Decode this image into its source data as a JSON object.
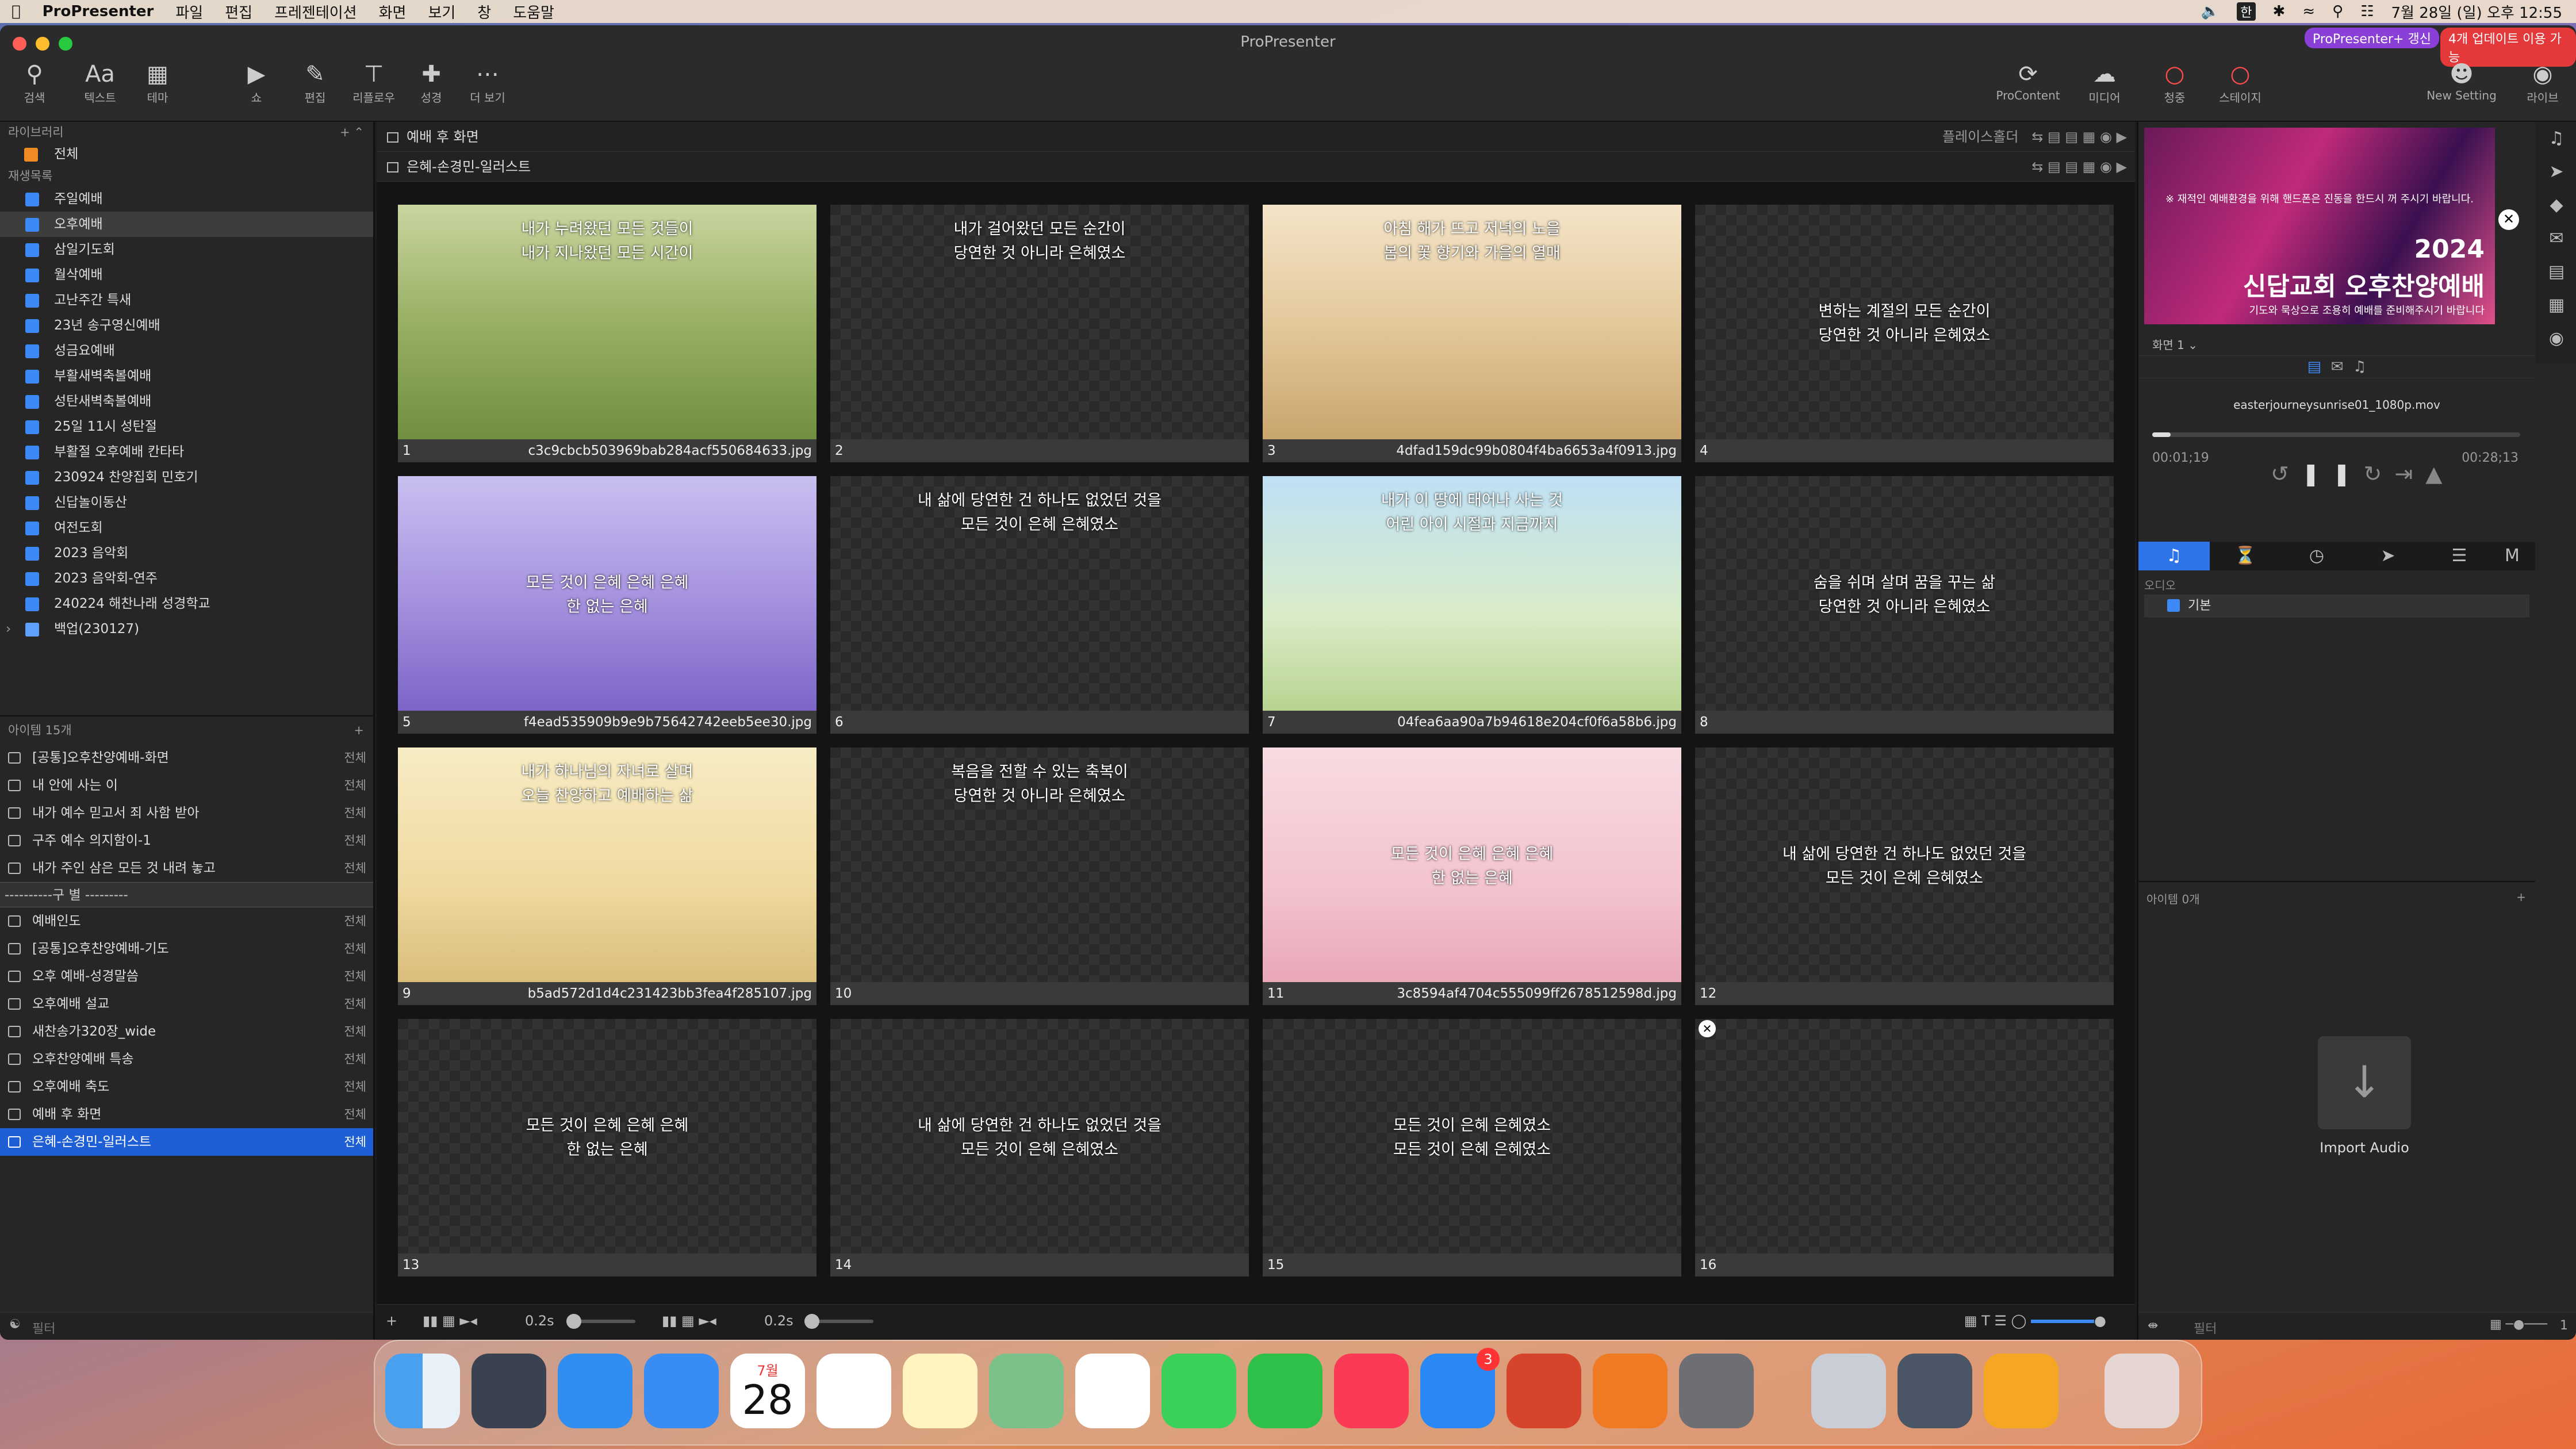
{
  "menubar": {
    "app": "ProPresenter",
    "items": [
      "파일",
      "편집",
      "프레젠테이션",
      "화면",
      "보기",
      "창",
      "도움말"
    ],
    "badge1": "ProPresenter+ 갱신",
    "badge2": "4개 업데이트 이용 가능",
    "clock": "7월 28일 (일) 오후 12:55",
    "ime": "한"
  },
  "window": {
    "title": "ProPresenter"
  },
  "toolbar": {
    "search": "검색",
    "text": "텍스트",
    "theme": "테마",
    "show": "쇼",
    "edit": "편집",
    "reflow": "리플로우",
    "bible": "성경",
    "more": "더 보기",
    "procontent": "ProContent",
    "media": "미디어",
    "audio": "청중",
    "stage": "스테이지",
    "newsetting": "New Setting",
    "live": "라이브"
  },
  "library": {
    "header": "라이브러리",
    "all": "전체",
    "playlists_header": "재생목록",
    "playlists": [
      "주일예배",
      "오후예배",
      "삼일기도회",
      "월삭예배",
      "고난주간 특새",
      "23년 송구영신예배",
      "성금요예배",
      "부활새벽축볼예배",
      "성탄새벽축볼예배",
      "25일 11시 성탄절",
      "부활절 오후예배 칸타타",
      "230924 찬양집회 민호기",
      "신답놀이동산",
      "여전도회",
      "2023 음악회",
      "2023 음악회-연주",
      "240224 해찬나래 성경학교",
      "백업(230127)"
    ],
    "selected_index": 1
  },
  "items": {
    "header": "아이템 15개",
    "all_label": "전체",
    "rows": [
      "[공통]오후찬양예배-화면",
      "내 안에 사는 이",
      "내가 예수 믿고서 죄 사함 받아",
      "구주 예수 의지함이-1",
      "내가 주인 삼은 모든 것 내려 놓고",
      "----------구 별 ---------",
      "예배인도",
      "[공통]오후찬양예배-기도",
      "오후 예배-성경말씀",
      "오후예배 설교",
      "새찬송가320장_wide",
      "오후찬양예배 특송",
      "오후예배 축도",
      "예배 후 화면",
      "은혜-손경민-일러스트"
    ],
    "filter": "필터"
  },
  "center": {
    "top_header": "예배 후 화면",
    "top_right": "플레이스홀더",
    "doc_header": "은혜-손경민-일러스트",
    "speed_a": "0.2s",
    "speed_b": "0.2s"
  },
  "slides": [
    {
      "n": "1",
      "text": "내가 누려왔던 모든 것들이\n내가 지나왔던 모든 시간이",
      "file": "c3c9cbcb503969bab284acf550684633.jpg",
      "bg": "green"
    },
    {
      "n": "2",
      "text": "내가 걸어왔던 모든 순간이\n당연한 것 아니라 은혜였소",
      "file": "",
      "bg": ""
    },
    {
      "n": "3",
      "text": "아침 해가 뜨고 저녁의 노을\n봄의 꽃 향기와 가을의 열매",
      "file": "4dfad159dc99b0804f4ba6653a4f0913.jpg",
      "bg": "forest"
    },
    {
      "n": "4",
      "text": "변하는 계절의 모든 순간이\n당연한 것 아니라 은혜였소",
      "file": "",
      "bg": ""
    },
    {
      "n": "5",
      "text": "모든 것이 은혜 은혜 은혜\n한 없는 은혜",
      "file": "f4ead535909b9e9b75642742eeb5ee30.jpg",
      "bg": "lavender"
    },
    {
      "n": "6",
      "text": "내 삶에 당연한 건 하나도 없었던 것을\n모든 것이 은혜 은혜였소",
      "file": "",
      "bg": ""
    },
    {
      "n": "7",
      "text": "내가 이 땅에 태어나 사는 것\n어린 아이 시절과 지금까지",
      "file": "04fea6aa90a7b94618e204cf0f6a58b6.jpg",
      "bg": "sky"
    },
    {
      "n": "8",
      "text": "숨을 쉬며 살며 꿈을 꾸는 삶\n당연한 것 아니라 은혜였소",
      "file": "",
      "bg": ""
    },
    {
      "n": "9",
      "text": "내가 하나님의 자녀로 살며\n오늘 찬양하고 예배하는 삶",
      "file": "b5ad572d1d4c231423bb3fea4f285107.jpg",
      "bg": "cream"
    },
    {
      "n": "10",
      "text": "복음을 전할 수 있는 축복이\n당연한 것 아니라 은혜였소",
      "file": "",
      "bg": ""
    },
    {
      "n": "11",
      "text": "모든 것이 은혜 은혜 은혜\n한 없는 은혜",
      "file": "3c8594af4704c555099ff2678512598d.jpg",
      "bg": "pink"
    },
    {
      "n": "12",
      "text": "내 삶에 당연한 건 하나도 없었던 것을\n모든 것이 은혜 은혜였소",
      "file": "",
      "bg": ""
    },
    {
      "n": "13",
      "text": "모든 것이 은혜 은혜 은혜\n한 없는 은혜",
      "file": "",
      "bg": ""
    },
    {
      "n": "14",
      "text": "내 삶에 당연한 건 하나도 없었던 것을\n모든 것이 은혜 은혜였소",
      "file": "",
      "bg": ""
    },
    {
      "n": "15",
      "text": "모든 것이 은혜 은혜였소\n모든 것이 은혜 은혜였소",
      "file": "",
      "bg": ""
    },
    {
      "n": "16",
      "text": "",
      "file": "",
      "bg": ""
    }
  ],
  "preview": {
    "banner": "※ 재적인 예배환경을 위해 핸드폰은 진동을 한드시 꺼 주시기 바랍니다.",
    "year": "2024",
    "title": "신답교회 오후찬양예배",
    "sub": "기도와 묵상으로 조용히 예배를 준비해주시기 바랍니다",
    "screen": "화면 1"
  },
  "media": {
    "file": "easterjourneysunrise01_1080p.mov",
    "elapsed": "00:01;19",
    "remaining": "00:28;13",
    "progress_fraction": 0.05
  },
  "audio": {
    "header": "오디오",
    "default": "기본",
    "items": "아이템 0개",
    "import": "Import Audio",
    "filter": "필터",
    "count": "1"
  },
  "dock": {
    "calendar_month": "7월",
    "calendar_day": "28",
    "appstore_badge": "3"
  }
}
